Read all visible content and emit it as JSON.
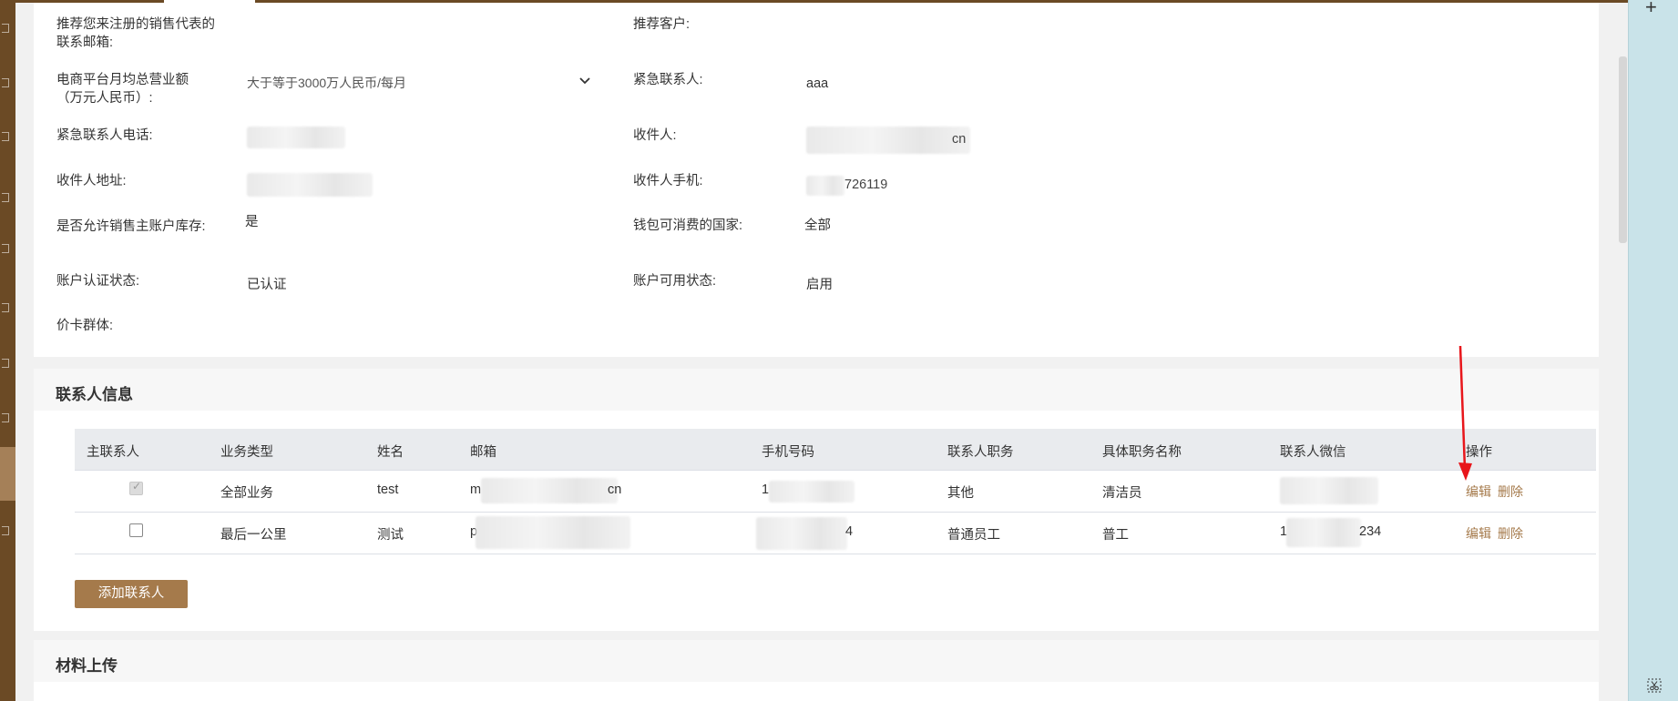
{
  "fields": {
    "referral_email_label": "推荐您来注册的销售代表的联系邮箱:",
    "referral_customer_label": "推荐客户:",
    "monthly_revenue_label": "电商平台月均总营业额（万元人民币）:",
    "monthly_revenue_value": "大于等于3000万人民币/每月",
    "emergency_contact_label": "紧急联系人:",
    "emergency_contact_value": "aaa",
    "emergency_phone_label": "紧急联系人电话:",
    "recipient_label": "收件人:",
    "recipient_value_tail": "cn",
    "recipient_address_label": "收件人地址:",
    "recipient_mobile_label": "收件人手机:",
    "recipient_mobile_value_tail": "726119",
    "allow_sales_label": "是否允许销售主账户库存:",
    "allow_sales_value": "是",
    "wallet_country_label": "钱包可消费的国家:",
    "wallet_country_value": "全部",
    "auth_status_label": "账户认证状态:",
    "auth_status_value": "已认证",
    "available_status_label": "账户可用状态:",
    "available_status_value": "启用",
    "price_group_label": "价卡群体:"
  },
  "contacts": {
    "title": "联系人信息",
    "columns": [
      "主联系人",
      "业务类型",
      "姓名",
      "邮箱",
      "手机号码",
      "联系人职务",
      "具体职务名称",
      "联系人微信",
      "操作"
    ],
    "rows": [
      {
        "primary": true,
        "business": "全部业务",
        "name": "test",
        "email_head": "m",
        "email_tail": "cn",
        "phone_head": "1",
        "position": "其他",
        "job_title": "清洁员",
        "edit": "编辑",
        "delete": "删除"
      },
      {
        "primary": false,
        "business": "最后一公里",
        "name": "测试",
        "email_head": "p",
        "phone_tail": "4",
        "position": "普通员工",
        "job_title": "普工",
        "wechat_head": "1",
        "wechat_tail": "234",
        "edit": "编辑",
        "delete": "删除"
      }
    ],
    "add_button": "添加联系人"
  },
  "materials": {
    "title": "材料上传"
  },
  "right_panel": {
    "plus_glyph": "+"
  },
  "colors": {
    "brand_brown": "#6b4a25",
    "accent_gold": "#a57a4b",
    "annotation_red": "#e8161b",
    "side_panel": "#c9e3e9"
  },
  "icons": [
    "chevron-down-icon",
    "plus-icon",
    "scissor-icon",
    "checkbox-icon"
  ]
}
